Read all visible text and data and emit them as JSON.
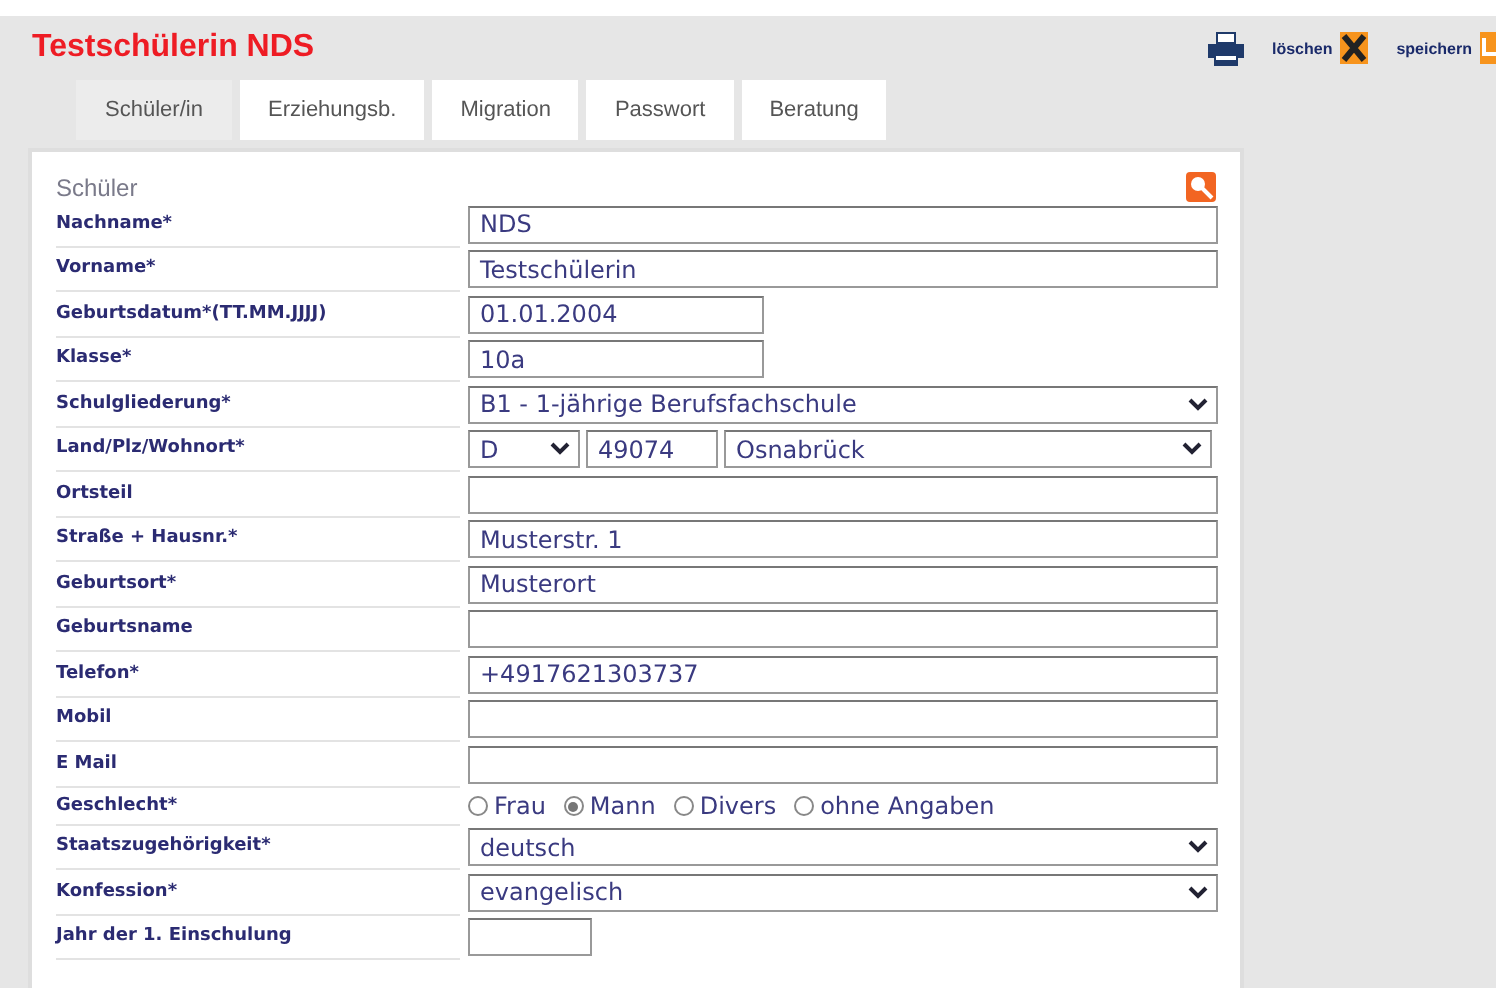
{
  "header": {
    "title": "Testschülerin NDS",
    "actions": [
      "löschen",
      "speichern"
    ]
  },
  "tabs": [
    {
      "label": "Schüler/in",
      "selected": true
    },
    {
      "label": "Erziehungsb.",
      "selected": false
    },
    {
      "label": "Migration",
      "selected": false
    },
    {
      "label": "Passwort",
      "selected": false
    },
    {
      "label": "Beratung",
      "selected": false
    }
  ],
  "section": {
    "title": "Schüler"
  },
  "rows": [
    {
      "label": "Nachname*",
      "kind": "text",
      "value": "NDS"
    },
    {
      "label": "Vorname*",
      "kind": "text",
      "value": "Testschülerin"
    },
    {
      "label": "Geburtsdatum*(TT.MM.JJJJ)",
      "kind": "short",
      "value": "01.01.2004"
    },
    {
      "label": "Klasse*",
      "kind": "short",
      "value": "10a"
    },
    {
      "label": "Schulgliederung*",
      "kind": "select",
      "value": "B1 - 1-jährige Berufsfachschule"
    },
    {
      "label": "Land/Plz/Wohnort*",
      "kind": "location",
      "country": "D",
      "zip": "49074",
      "city": "Osnabrück"
    },
    {
      "label": "Ortsteil",
      "kind": "text"
    },
    {
      "label": "Straße + Hausnr.*",
      "kind": "text",
      "value": "Musterstr. 1"
    },
    {
      "label": "Geburtsort*",
      "kind": "text",
      "value": "Musterort"
    },
    {
      "label": "Geburtsname",
      "kind": "text"
    },
    {
      "label": "Telefon*",
      "kind": "text",
      "value": "+4917621303737"
    },
    {
      "label": "Mobil",
      "kind": "text"
    },
    {
      "label": "E Mail",
      "kind": "text"
    },
    {
      "label": "Geschlecht*",
      "kind": "radio",
      "options": [
        {
          "label": "Frau",
          "selected": false
        },
        {
          "label": "Mann",
          "selected": true
        },
        {
          "label": "Divers",
          "selected": false
        },
        {
          "label": "ohne Angaben",
          "selected": false
        }
      ]
    },
    {
      "label": "Staatszugehörigkeit*",
      "kind": "select",
      "value": "deutsch"
    },
    {
      "label": "Konfession*",
      "kind": "select",
      "value": "evangelisch"
    },
    {
      "label": "Jahr der 1. Einschulung",
      "kind": "tiny"
    }
  ]
}
